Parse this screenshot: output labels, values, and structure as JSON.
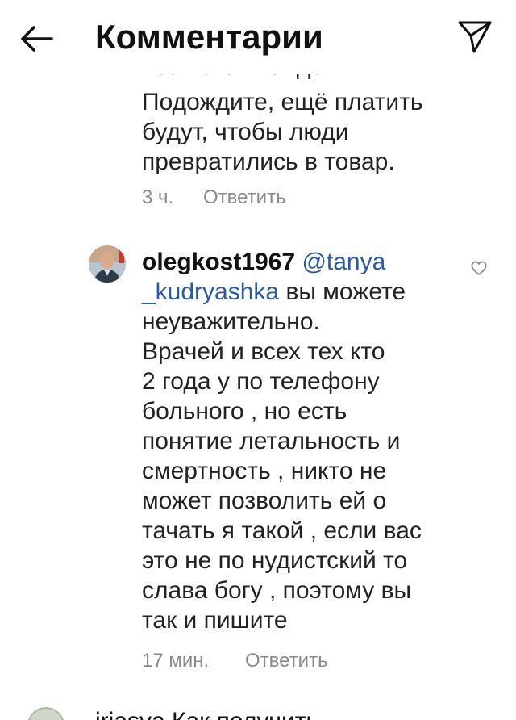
{
  "header": {
    "title": "Комментарии",
    "back_icon": "arrow-left-icon",
    "send_icon": "paper-plane-icon"
  },
  "prev_comment": {
    "partial_line": "всей этой пандемии.",
    "lines": [
      "Подождите, ещё платить",
      "будут, чтобы люди",
      "превратились в товар."
    ],
    "time": "3 ч.",
    "reply_label": "Ответить"
  },
  "comment": {
    "username": "olegkost1967",
    "mention_part1": "@tanya",
    "mention_part2": "_kudryashka",
    "first_line_rest": "вы можете",
    "lines": [
      "неуважительно.",
      "Врачей и всех тех кто",
      "2 года  у по телефону",
      "больного , но есть",
      "понятие летальность и",
      "смертность , никто не",
      "может позволить ей о",
      "тачать я такой , если вас",
      "это не по нудистский то",
      "слава богу , поэтому вы",
      "так и пишите"
    ],
    "time": "17 мин.",
    "reply_label": "Ответить",
    "like_icon": "heart-icon"
  },
  "next_comment": {
    "partial_text": "iriasva  Как получить"
  }
}
